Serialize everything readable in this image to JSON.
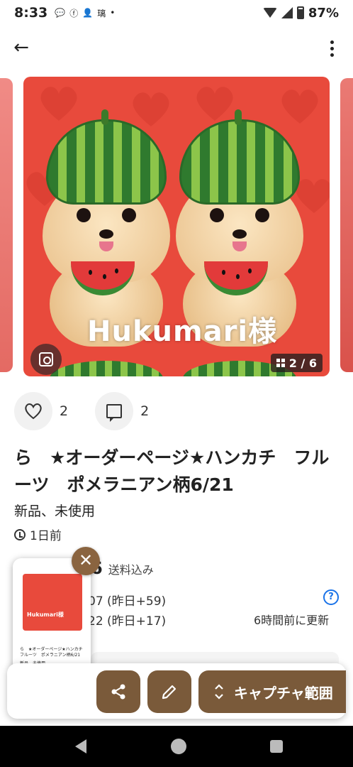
{
  "status_bar": {
    "time": "8:33",
    "battery": "87%",
    "icons": [
      "message-icon",
      "facebook-icon",
      "person-add-icon",
      "kanji-notification-icon",
      "dot-icon",
      "wifi-icon",
      "signal-icon",
      "battery-icon"
    ]
  },
  "app_bar": {
    "back_icon": "arrow-left-icon",
    "more_icon": "more-vertical-icon"
  },
  "carousel": {
    "overlay_text": "Hukumari様",
    "counter": "2 / 6",
    "lens_icon": "image-search-icon"
  },
  "reactions": {
    "likes": "2",
    "comments": "2"
  },
  "listing": {
    "title": "ら　★オーダーページ★ハンカチ　フルーツ　ポメラニアン柄6/21",
    "condition": "新品、未使用",
    "posted": "1日前",
    "price_fragment": "6",
    "shipping": "送料込み",
    "stat_views": "07 (昨日+59)",
    "stat_likes": "22 (昨日+17)",
    "updated": "6時間前に更新",
    "help": "?"
  },
  "preview": {
    "overlay_text": "Hukumari様",
    "title": "ら　★オーダーページ★ハンカチ　フルーツ　ポメラニアン柄6/21",
    "condition": "新品、未使用"
  },
  "actions": {
    "capture_label": "キャプチャ範囲"
  },
  "colors": {
    "accent": "#7a5a3a",
    "image_bg": "#e84a3c",
    "help": "#1a73e8"
  }
}
